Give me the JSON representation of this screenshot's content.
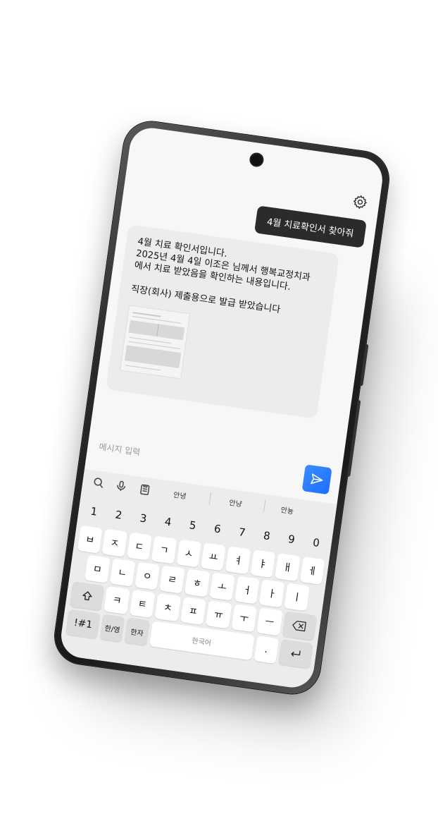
{
  "chat": {
    "user_message": "4월 치료확인서 찾아줘",
    "bot_lines": [
      "4월 치료 확인서입니다.",
      "2025년 4월 4일 이조은 님께서 행복교정치과",
      "에서 치료 받았음을 확인하는 내용입니다.",
      "직장(회사) 제출용으로 발급 받았습니다"
    ]
  },
  "input": {
    "placeholder": "메시지 입력"
  },
  "keyboard": {
    "suggestions": [
      "안녕",
      "안냥",
      "안뇽"
    ],
    "num_row": [
      "1",
      "2",
      "3",
      "4",
      "5",
      "6",
      "7",
      "8",
      "9",
      "0"
    ],
    "row1": [
      "ㅂ",
      "ㅈ",
      "ㄷ",
      "ㄱ",
      "ㅅ",
      "ㅛ",
      "ㅕ",
      "ㅑ",
      "ㅐ",
      "ㅔ"
    ],
    "row2": [
      "ㅁ",
      "ㄴ",
      "ㅇ",
      "ㄹ",
      "ㅎ",
      "ㅗ",
      "ㅓ",
      "ㅏ",
      "ㅣ"
    ],
    "row3": [
      "ㅋ",
      "ㅌ",
      "ㅊ",
      "ㅍ",
      "ㅠ",
      "ㅜ",
      "ㅡ"
    ],
    "sym_label": "!#1",
    "lang_label": "한/영",
    "hanja_label": "한자",
    "space_label": "한국어",
    "period_label": "."
  },
  "icons": [
    "gear-icon",
    "search-icon",
    "mic-icon",
    "clipboard-icon",
    "send-icon",
    "shift-icon",
    "backspace-icon",
    "enter-icon"
  ],
  "colors": {
    "send_button": "#1e6fff",
    "user_bubble": "#2b2b2b",
    "bot_bubble": "#ececec"
  }
}
